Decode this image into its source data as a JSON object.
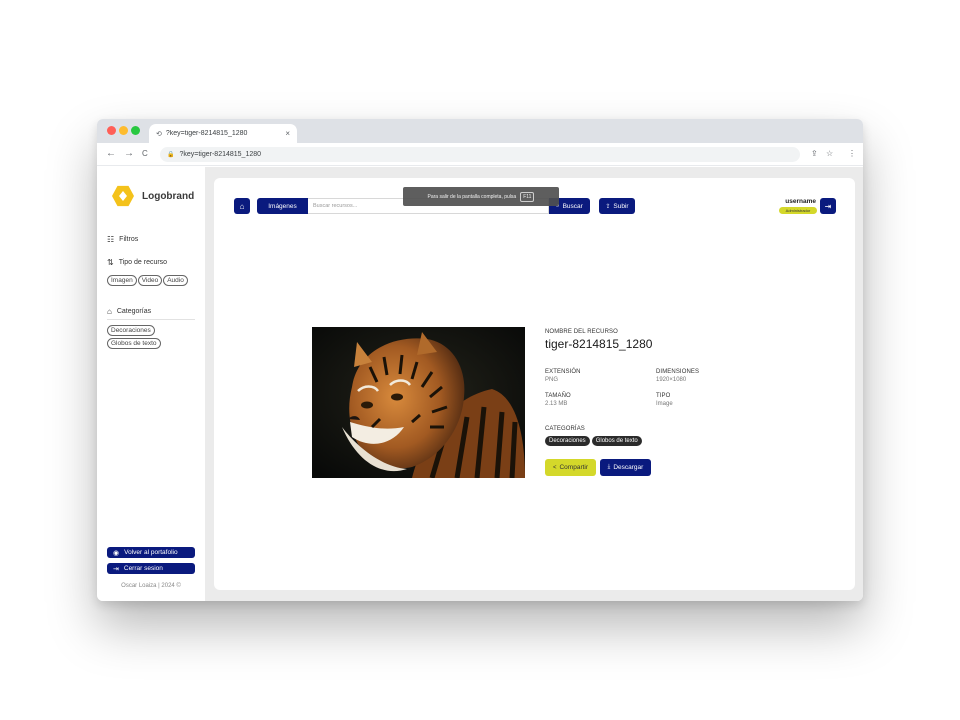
{
  "browser": {
    "tab_title": "?key=tiger-8214815_1280",
    "tab_close": "×",
    "url": "?key=tiger-8214815_1280",
    "back": "←",
    "forward": "→",
    "reload": "C",
    "share_icon": "⇪",
    "star_icon": "☆",
    "menu_icon": "⋮"
  },
  "sidebar": {
    "brand": "Logobrand",
    "filters_label": "Filtros",
    "resource_type_label": "Tipo de recurso",
    "resource_types": [
      "Imagen",
      "Video",
      "Audio"
    ],
    "categories_label": "Categorías",
    "categories": [
      "Decoraciones",
      "Globos de texto"
    ],
    "portfolio_button": "Volver al portafolio",
    "logout_button": "Cerrar sesion",
    "footer": "Oscar Loaiza | 2024 ©"
  },
  "header": {
    "search_type": "Imágenes",
    "search_placeholder": "Buscar recursos...",
    "search_button": "Buscar",
    "upload_button": "Subir",
    "fullscreen_notice": "Para salir de la pantalla completa, pulsa",
    "fullscreen_key": "F11",
    "username": "username",
    "role": "Administrador"
  },
  "resource": {
    "name_label": "NOMBRE DEL RECURSO",
    "name": "tiger-8214815_1280",
    "extension_label": "EXTENSIÓN",
    "extension": "PNG",
    "dimensions_label": "DIMENSIONES",
    "dimensions": "1920×1080",
    "size_label": "TAMAÑO",
    "size": "2.13 MB",
    "type_label": "TIPO",
    "type": "Image",
    "categories_label": "CATEGORÍAS",
    "categories": [
      "Decoraciones",
      "Globos de texto"
    ],
    "share_button": "Compartir",
    "download_button": "Descargar"
  },
  "colors": {
    "primary": "#0a1a7e",
    "accent": "#d4d82a",
    "logo": "#f4c21b"
  }
}
